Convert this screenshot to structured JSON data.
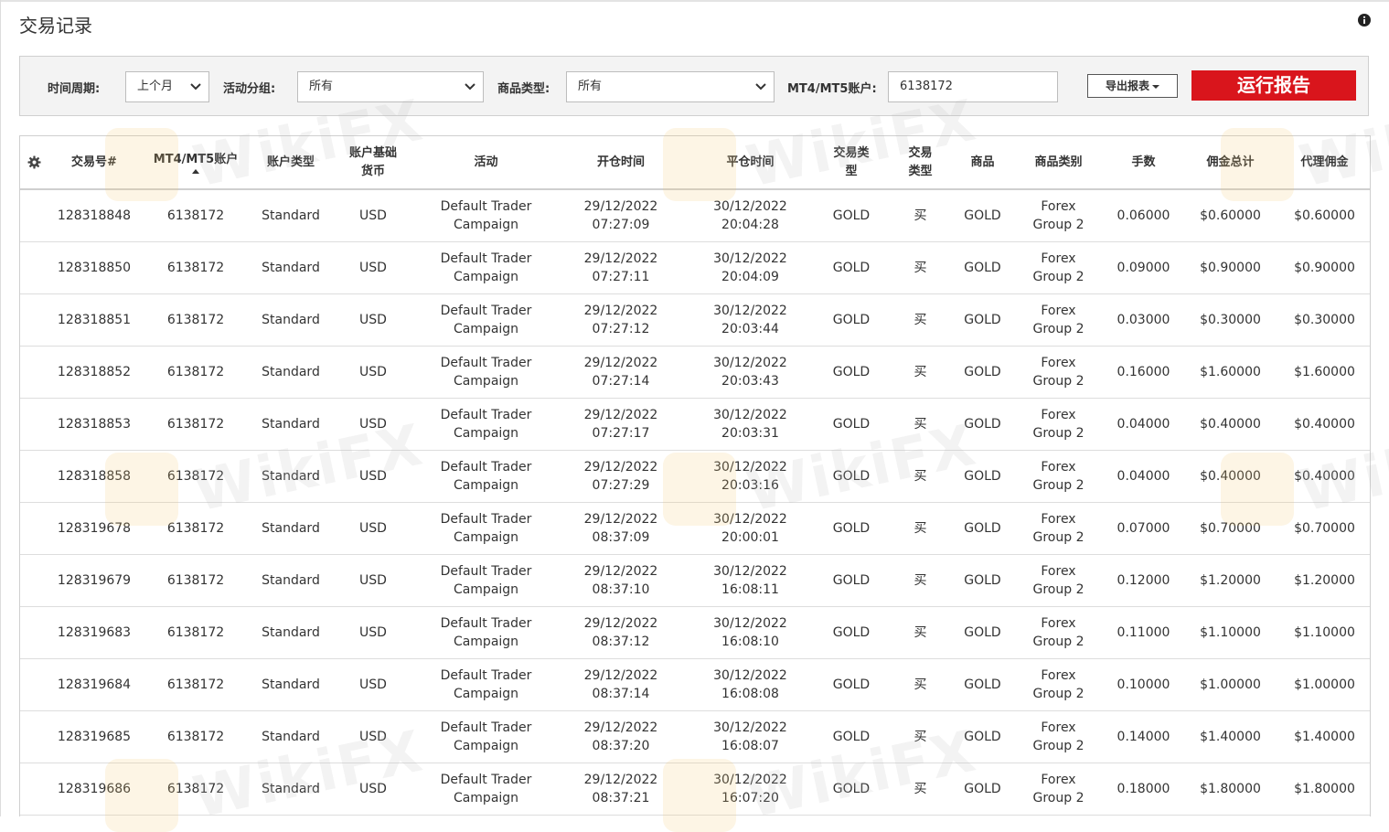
{
  "page": {
    "title": "交易记录"
  },
  "filters": {
    "period": {
      "label": "时间周期:",
      "value": "上个月"
    },
    "group": {
      "label": "活动分组:",
      "value": "所有"
    },
    "product_type": {
      "label": "商品类型:",
      "value": "所有"
    },
    "account": {
      "label": "MT4/MT5账户:",
      "value": "6138172"
    },
    "export_label": "导出报表",
    "run_label": "运行报告"
  },
  "table": {
    "headers": {
      "trade_no": "交易号#",
      "account": "MT4/MT5账户",
      "account_type": "账户类型",
      "currency_1": "账户基础",
      "currency_2": "货币",
      "campaign": "活动",
      "open_time": "开仓时间",
      "close_time": "平仓时间",
      "trade_category_1": "交易类",
      "trade_category_2": "型",
      "trade_type_1": "交易",
      "trade_type_2": "类型",
      "product": "商品",
      "product_group": "商品类别",
      "lots": "手数",
      "commission_total": "佣金总计",
      "agent_commission": "代理佣金"
    },
    "rows": [
      {
        "trade_no": "128318848",
        "account": "6138172",
        "account_type": "Standard",
        "currency": "USD",
        "campaign_1": "Default Trader",
        "campaign_2": "Campaign",
        "open_date": "29/12/2022",
        "open_time": "07:27:09",
        "close_date": "30/12/2022",
        "close_time": "20:04:28",
        "trade_category": "GOLD",
        "trade_type": "买",
        "product": "GOLD",
        "group_1": "Forex",
        "group_2": "Group 2",
        "lots": "0.06000",
        "commission_total": "$0.60000",
        "agent_commission": "$0.60000"
      },
      {
        "trade_no": "128318850",
        "account": "6138172",
        "account_type": "Standard",
        "currency": "USD",
        "campaign_1": "Default Trader",
        "campaign_2": "Campaign",
        "open_date": "29/12/2022",
        "open_time": "07:27:11",
        "close_date": "30/12/2022",
        "close_time": "20:04:09",
        "trade_category": "GOLD",
        "trade_type": "买",
        "product": "GOLD",
        "group_1": "Forex",
        "group_2": "Group 2",
        "lots": "0.09000",
        "commission_total": "$0.90000",
        "agent_commission": "$0.90000"
      },
      {
        "trade_no": "128318851",
        "account": "6138172",
        "account_type": "Standard",
        "currency": "USD",
        "campaign_1": "Default Trader",
        "campaign_2": "Campaign",
        "open_date": "29/12/2022",
        "open_time": "07:27:12",
        "close_date": "30/12/2022",
        "close_time": "20:03:44",
        "trade_category": "GOLD",
        "trade_type": "买",
        "product": "GOLD",
        "group_1": "Forex",
        "group_2": "Group 2",
        "lots": "0.03000",
        "commission_total": "$0.30000",
        "agent_commission": "$0.30000"
      },
      {
        "trade_no": "128318852",
        "account": "6138172",
        "account_type": "Standard",
        "currency": "USD",
        "campaign_1": "Default Trader",
        "campaign_2": "Campaign",
        "open_date": "29/12/2022",
        "open_time": "07:27:14",
        "close_date": "30/12/2022",
        "close_time": "20:03:43",
        "trade_category": "GOLD",
        "trade_type": "买",
        "product": "GOLD",
        "group_1": "Forex",
        "group_2": "Group 2",
        "lots": "0.16000",
        "commission_total": "$1.60000",
        "agent_commission": "$1.60000"
      },
      {
        "trade_no": "128318853",
        "account": "6138172",
        "account_type": "Standard",
        "currency": "USD",
        "campaign_1": "Default Trader",
        "campaign_2": "Campaign",
        "open_date": "29/12/2022",
        "open_time": "07:27:17",
        "close_date": "30/12/2022",
        "close_time": "20:03:31",
        "trade_category": "GOLD",
        "trade_type": "买",
        "product": "GOLD",
        "group_1": "Forex",
        "group_2": "Group 2",
        "lots": "0.04000",
        "commission_total": "$0.40000",
        "agent_commission": "$0.40000"
      },
      {
        "trade_no": "128318858",
        "account": "6138172",
        "account_type": "Standard",
        "currency": "USD",
        "campaign_1": "Default Trader",
        "campaign_2": "Campaign",
        "open_date": "29/12/2022",
        "open_time": "07:27:29",
        "close_date": "30/12/2022",
        "close_time": "20:03:16",
        "trade_category": "GOLD",
        "trade_type": "买",
        "product": "GOLD",
        "group_1": "Forex",
        "group_2": "Group 2",
        "lots": "0.04000",
        "commission_total": "$0.40000",
        "agent_commission": "$0.40000"
      },
      {
        "trade_no": "128319678",
        "account": "6138172",
        "account_type": "Standard",
        "currency": "USD",
        "campaign_1": "Default Trader",
        "campaign_2": "Campaign",
        "open_date": "29/12/2022",
        "open_time": "08:37:09",
        "close_date": "30/12/2022",
        "close_time": "20:00:01",
        "trade_category": "GOLD",
        "trade_type": "买",
        "product": "GOLD",
        "group_1": "Forex",
        "group_2": "Group 2",
        "lots": "0.07000",
        "commission_total": "$0.70000",
        "agent_commission": "$0.70000"
      },
      {
        "trade_no": "128319679",
        "account": "6138172",
        "account_type": "Standard",
        "currency": "USD",
        "campaign_1": "Default Trader",
        "campaign_2": "Campaign",
        "open_date": "29/12/2022",
        "open_time": "08:37:10",
        "close_date": "30/12/2022",
        "close_time": "16:08:11",
        "trade_category": "GOLD",
        "trade_type": "买",
        "product": "GOLD",
        "group_1": "Forex",
        "group_2": "Group 2",
        "lots": "0.12000",
        "commission_total": "$1.20000",
        "agent_commission": "$1.20000"
      },
      {
        "trade_no": "128319683",
        "account": "6138172",
        "account_type": "Standard",
        "currency": "USD",
        "campaign_1": "Default Trader",
        "campaign_2": "Campaign",
        "open_date": "29/12/2022",
        "open_time": "08:37:12",
        "close_date": "30/12/2022",
        "close_time": "16:08:10",
        "trade_category": "GOLD",
        "trade_type": "买",
        "product": "GOLD",
        "group_1": "Forex",
        "group_2": "Group 2",
        "lots": "0.11000",
        "commission_total": "$1.10000",
        "agent_commission": "$1.10000"
      },
      {
        "trade_no": "128319684",
        "account": "6138172",
        "account_type": "Standard",
        "currency": "USD",
        "campaign_1": "Default Trader",
        "campaign_2": "Campaign",
        "open_date": "29/12/2022",
        "open_time": "08:37:14",
        "close_date": "30/12/2022",
        "close_time": "16:08:08",
        "trade_category": "GOLD",
        "trade_type": "买",
        "product": "GOLD",
        "group_1": "Forex",
        "group_2": "Group 2",
        "lots": "0.10000",
        "commission_total": "$1.00000",
        "agent_commission": "$1.00000"
      },
      {
        "trade_no": "128319685",
        "account": "6138172",
        "account_type": "Standard",
        "currency": "USD",
        "campaign_1": "Default Trader",
        "campaign_2": "Campaign",
        "open_date": "29/12/2022",
        "open_time": "08:37:20",
        "close_date": "30/12/2022",
        "close_time": "16:08:07",
        "trade_category": "GOLD",
        "trade_type": "买",
        "product": "GOLD",
        "group_1": "Forex",
        "group_2": "Group 2",
        "lots": "0.14000",
        "commission_total": "$1.40000",
        "agent_commission": "$1.40000"
      },
      {
        "trade_no": "128319686",
        "account": "6138172",
        "account_type": "Standard",
        "currency": "USD",
        "campaign_1": "Default Trader",
        "campaign_2": "Campaign",
        "open_date": "29/12/2022",
        "open_time": "08:37:21",
        "close_date": "30/12/2022",
        "close_time": "16:07:20",
        "trade_category": "GOLD",
        "trade_type": "买",
        "product": "GOLD",
        "group_1": "Forex",
        "group_2": "Group 2",
        "lots": "0.18000",
        "commission_total": "$1.80000",
        "agent_commission": "$1.80000"
      }
    ]
  },
  "icons": {
    "info": "info-icon",
    "settings": "gear-icon",
    "dropdown": "chevron-down-icon",
    "sort": "sort-asc-icon"
  },
  "colors": {
    "accent": "#d9151c",
    "filter_bg": "#f3f3f3",
    "border": "#cfcfcf"
  },
  "watermark": {
    "text": "WikiFX"
  }
}
